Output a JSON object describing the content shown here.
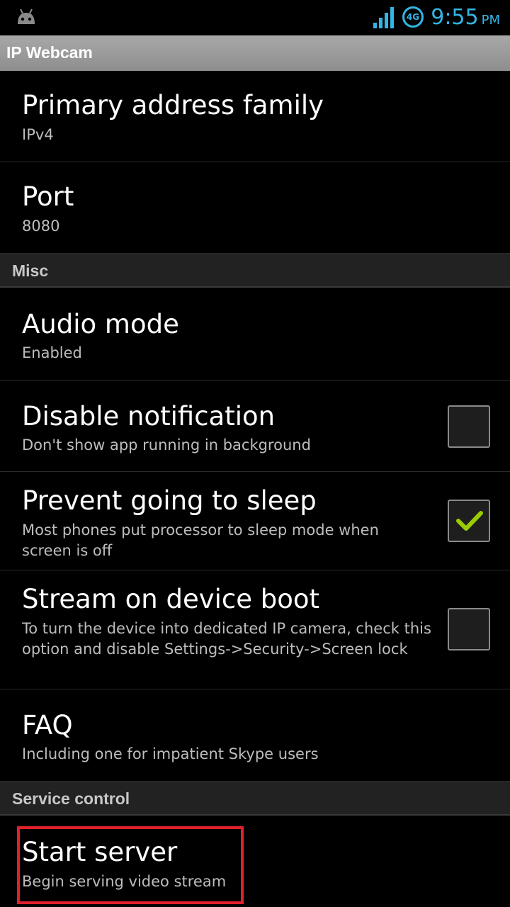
{
  "status_bar": {
    "network_label": "4G",
    "time": "9:55",
    "ampm": "PM",
    "accent_color": "#33b5e5",
    "icons": [
      "android-icon",
      "signal-icon",
      "network-icon"
    ]
  },
  "app": {
    "title": "IP Webcam"
  },
  "prefs": {
    "primary_address_family": {
      "title": "Primary address family",
      "summary": "IPv4"
    },
    "port": {
      "title": "Port",
      "summary": "8080"
    },
    "audio_mode": {
      "title": "Audio mode",
      "summary": "Enabled"
    },
    "disable_notification": {
      "title": "Disable notification",
      "summary": "Don't show app running in background",
      "checked": false
    },
    "prevent_sleep": {
      "title": "Prevent going to sleep",
      "summary": "Most phones put processor to sleep mode when screen is off",
      "checked": true
    },
    "stream_on_boot": {
      "title": "Stream on device boot",
      "summary": "To turn the device into dedicated IP camera, check this option and disable Settings->Security->Screen lock",
      "checked": false
    },
    "faq": {
      "title": "FAQ",
      "summary": "Including one for impatient Skype users"
    },
    "start_server": {
      "title": "Start server",
      "summary": "Begin serving video stream"
    }
  },
  "sections": {
    "misc": "Misc",
    "service_control": "Service control"
  },
  "colors": {
    "checkmark": "#99cc00",
    "highlight": "#e0202a"
  }
}
